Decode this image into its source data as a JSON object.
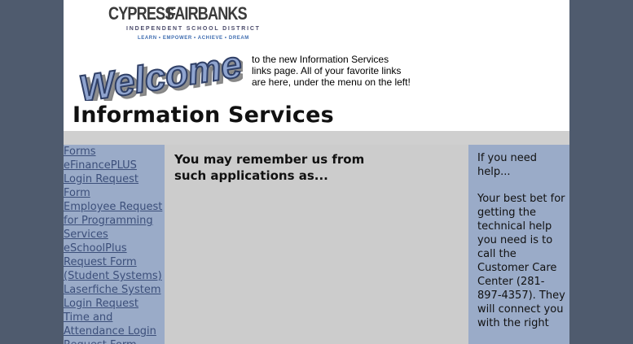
{
  "header": {
    "logo": {
      "word1": "CYPRESS",
      "word2": "FAIRBANKS",
      "subtitle": "INDEPENDENT SCHOOL DISTRICT",
      "tagline": "LEARN • EMPOWER • ACHIEVE • DREAM"
    },
    "welcome_graphic_text": "Welcome!",
    "intro_line1": "to the new Information Services",
    "intro_line2": "links page. All of your favorite links",
    "intro_line3": "are here, under the menu on the left!",
    "page_title": "Information Services"
  },
  "sidebar": {
    "items": [
      {
        "label": "Forms",
        "level": "top"
      },
      {
        "label": "eFinancePLUS Login Request Form",
        "level": "sub"
      },
      {
        "label": "Employee Request for Programming Services",
        "level": "sub"
      },
      {
        "label": "eSchoolPlus Request Form (Student Systems)",
        "level": "sub"
      },
      {
        "label": "Laserfiche System Login Request",
        "level": "sub"
      },
      {
        "label": "Time and Attendance Login Request Form",
        "level": "sub"
      }
    ]
  },
  "main": {
    "heading": "You may remember us from such applications as..."
  },
  "help_box": {
    "heading": "If you need help...",
    "body": "Your best bet for getting the technical help you need is to call the Customer Care Center (281-897-4357). They will connect you with the right"
  },
  "colors": {
    "page_background": "#4f5b6e",
    "sidebar_background": "#9aabc8",
    "content_background": "#cccccc",
    "link_color": "#3c4f7a"
  }
}
